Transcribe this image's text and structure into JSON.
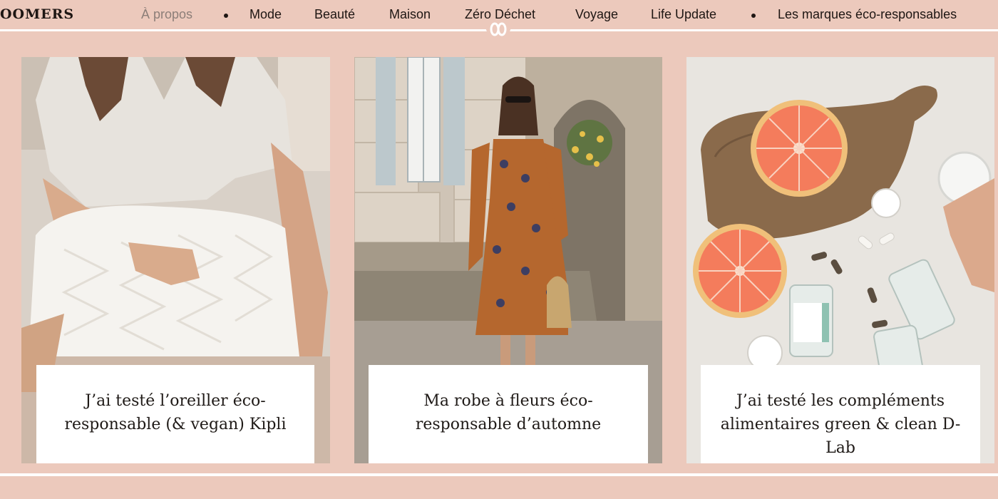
{
  "site": {
    "logo_text": "OOMERS"
  },
  "nav": {
    "items": [
      {
        "label": "À propos",
        "active": true
      },
      {
        "label": "Mode"
      },
      {
        "label": "Beauté"
      },
      {
        "label": "Maison"
      },
      {
        "label": "Zéro Déchet"
      },
      {
        "label": "Voyage"
      },
      {
        "label": "Life Update"
      },
      {
        "label": "Les marques éco-responsables"
      }
    ]
  },
  "articles": [
    {
      "title": "J’ai testé l’oreiller éco-responsable (& vegan) Kipli"
    },
    {
      "title": "Ma robe à fleurs éco-responsable d’automne"
    },
    {
      "title": "J’ai testé les compléments alimentaires green & clean D-Lab"
    }
  ],
  "colors": {
    "background": "#ecc9bc",
    "nav_text": "#1e1613",
    "nav_active": "#8c7e78",
    "caption_bg": "#ffffff"
  }
}
